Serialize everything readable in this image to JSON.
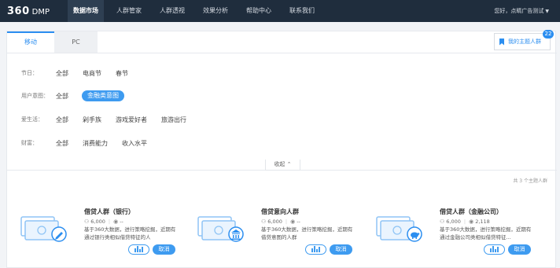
{
  "nav": {
    "logo_num": "360",
    "logo_text": "DMP",
    "items": [
      "数据市场",
      "人群管家",
      "人群透视",
      "效果分析",
      "帮助中心",
      "联系我们"
    ],
    "user": "您好，点睛广告测试"
  },
  "tabs": [
    "移动",
    "PC"
  ],
  "my_group": {
    "label": "我的主题人群",
    "count": "22"
  },
  "filters": [
    {
      "label": "节日：",
      "options": [
        "全部",
        "电商节",
        "春节"
      ],
      "selected": 0
    },
    {
      "label": "用户意图：",
      "options": [
        "全部",
        "金融类意图"
      ],
      "selected": 1
    },
    {
      "label": "爱生活：",
      "options": [
        "全部",
        "剁手族",
        "游戏爱好者",
        "旅游出行"
      ],
      "selected": 0
    },
    {
      "label": "财富：",
      "options": [
        "全部",
        "消费能力",
        "收入水平"
      ],
      "selected": 0
    }
  ],
  "fold_label": "收起",
  "count_text": "共 3 个主题人群",
  "audiences": [
    {
      "title": "借贷人群（银行）",
      "people": "6,000",
      "views": "--",
      "desc": "基于360大数据，进行策略挖掘，近期有通过银行类相似借贷特征的人",
      "cancel": "取消"
    },
    {
      "title": "借贷意向人群",
      "people": "6,000",
      "views": "--",
      "desc": "基于360大数据，进行策略挖掘，近期有借贷意图的人群",
      "cancel": "取消"
    },
    {
      "title": "借贷人群（金融公司）",
      "people": "6,000",
      "views": "2,118",
      "desc": "基于360大数据，进行策略挖掘，近期有通过金融公司类相似借贷特征...",
      "cancel": "取消"
    }
  ],
  "colors": {
    "nav_bg": "#1f2d3d",
    "accent": "#2b8ef0",
    "pill": "#3e9bf0"
  }
}
